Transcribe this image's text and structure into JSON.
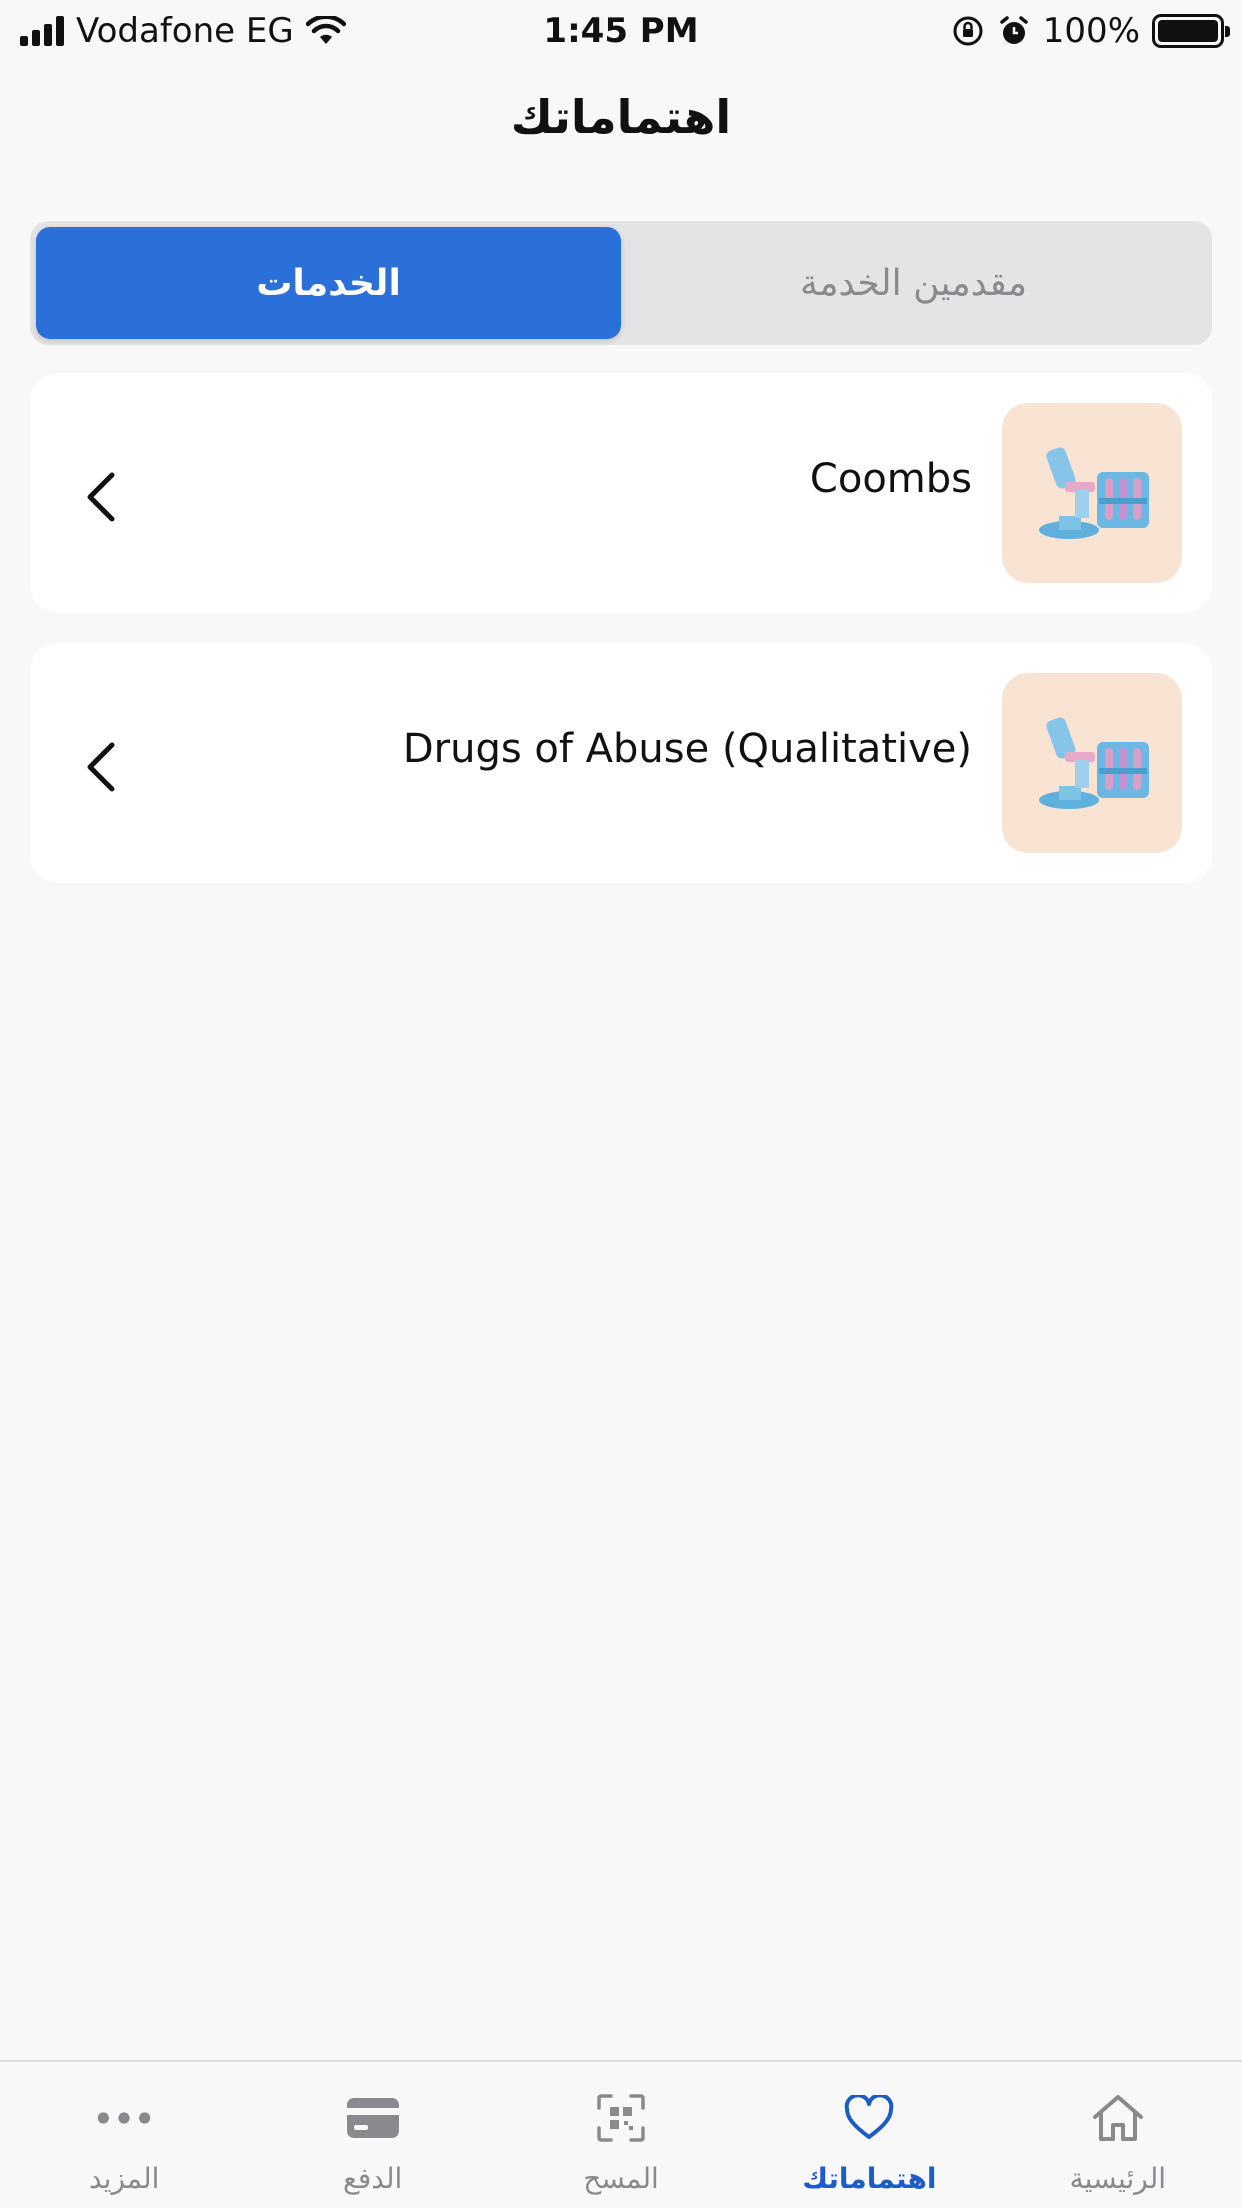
{
  "status_bar": {
    "carrier": "Vodafone EG",
    "time": "1:45 PM",
    "battery": "100%"
  },
  "page_title": "اهتماماتك",
  "segmented": {
    "tabs": [
      {
        "label": "مقدمين الخدمة",
        "selected": false
      },
      {
        "label": "الخدمات",
        "selected": true
      }
    ]
  },
  "favorites": [
    {
      "title": "Coombs",
      "icon": "lab-microscope-icon"
    },
    {
      "title": "Drugs of Abuse (Qualitative)",
      "icon": "lab-microscope-icon"
    }
  ],
  "tabbar": {
    "items": [
      {
        "label": "المزيد",
        "icon": "more-dots-icon",
        "active": false
      },
      {
        "label": "الدفع",
        "icon": "card-icon",
        "active": false
      },
      {
        "label": "المسح",
        "icon": "qr-scan-icon",
        "active": false
      },
      {
        "label": "اهتماماتك",
        "icon": "heart-icon",
        "active": true
      },
      {
        "label": "الرئيسية",
        "icon": "home-icon",
        "active": false
      }
    ]
  },
  "colors": {
    "accent": "#2b6fd9",
    "active_tab": "#1c5cc8",
    "thumb_bg": "#f9e4d4",
    "background": "#f8f8f8"
  }
}
